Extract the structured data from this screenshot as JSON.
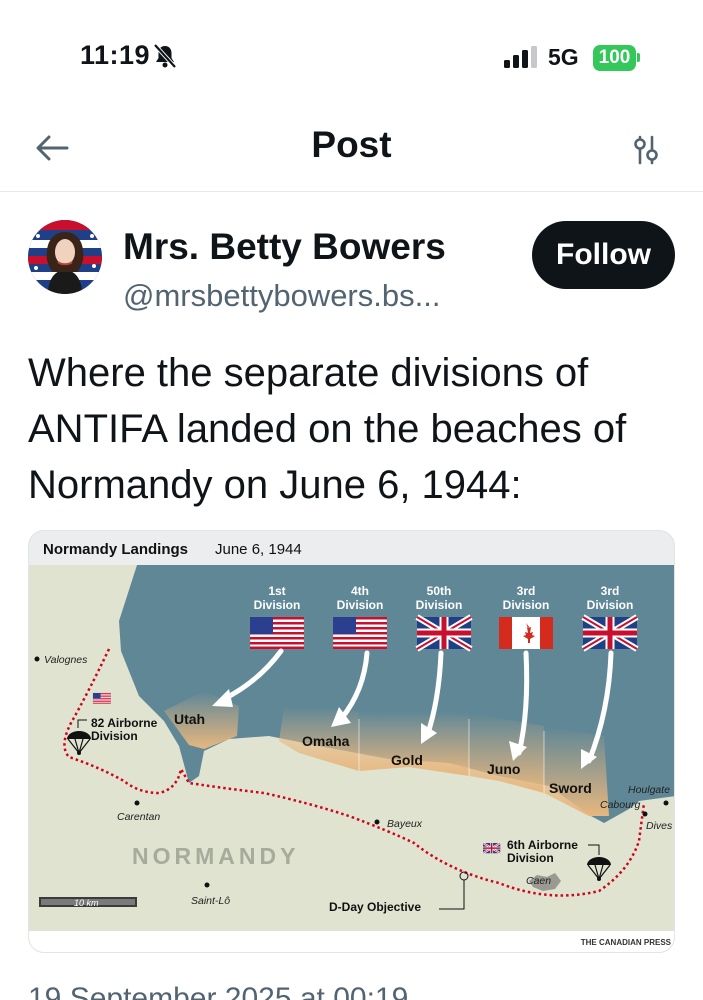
{
  "status": {
    "time": "11:19",
    "network": "5G",
    "battery": "100"
  },
  "nav": {
    "title": "Post"
  },
  "author": {
    "name": "Mrs. Betty Bowers",
    "handle": "@mrsbettybowers.bs...",
    "follow_label": "Follow"
  },
  "post": {
    "text": "Where the separate divisions of ANTIFA landed on the beaches of Normandy on June 6, 1944:",
    "timestamp": "19 September 2025 at 00:19"
  },
  "map": {
    "title": "Normandy Landings",
    "date": "June 6, 1944",
    "credit": "THE CANADIAN PRESS",
    "region_label": "NORMANDY",
    "objective_label": "D-Day Objective",
    "scale_label": "10 km",
    "divisions": [
      {
        "number": "1st",
        "label": "Division",
        "flag": "us-flag"
      },
      {
        "number": "4th",
        "label": "Division",
        "flag": "us-flag"
      },
      {
        "number": "50th",
        "label": "Division",
        "flag": "uk-flag"
      },
      {
        "number": "3rd",
        "label": "Division",
        "flag": "canada-flag"
      },
      {
        "number": "3rd",
        "label": "Division",
        "flag": "uk-flag"
      }
    ],
    "beaches": [
      "Utah",
      "Omaha",
      "Gold",
      "Juno",
      "Sword"
    ],
    "airborne": [
      {
        "line1": "82 Airborne",
        "line2": "Division",
        "flag": "us-flag"
      },
      {
        "line1": "6th Airborne",
        "line2": "Division",
        "flag": "uk-flag"
      }
    ],
    "towns": [
      "Valognes",
      "Carentan",
      "Bayeux",
      "Saint-Lô",
      "Caen",
      "Cabourg",
      "Houlgate",
      "Dives"
    ],
    "colors": {
      "sea": "#5f8796",
      "land": "#dfe3d0",
      "beach": "#e7b77f",
      "route": "#d0021b"
    }
  }
}
